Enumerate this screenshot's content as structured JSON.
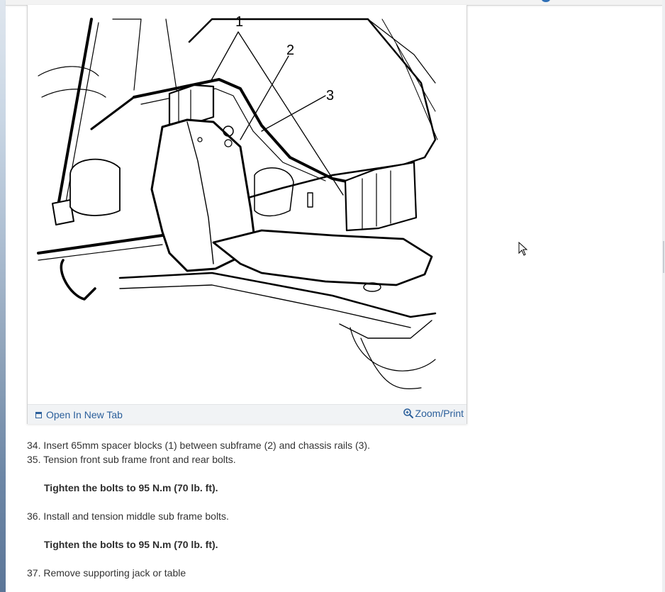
{
  "figure": {
    "callouts": [
      {
        "id": "callout-1",
        "label": "1"
      },
      {
        "id": "callout-2",
        "label": "2"
      },
      {
        "id": "callout-3",
        "label": "3"
      }
    ],
    "footer": {
      "open_new_tab_label": "Open In New Tab",
      "open_new_tab_icon": "open-new-tab-icon",
      "zoom_print_label": "Zoom/Print",
      "zoom_icon": "zoom-in-icon"
    }
  },
  "steps": [
    {
      "number": "34.",
      "text": "Insert 65mm spacer blocks (1) between subframe (2) and chassis rails (3).",
      "spec": ""
    },
    {
      "number": "35.",
      "text": "Tension front sub frame front and rear bolts.",
      "spec": "Tighten the bolts to 95 N.m (70 lb. ft)."
    },
    {
      "number": "36.",
      "text": "Install and tension middle sub frame bolts.",
      "spec": "Tighten the bolts to 95 N.m (70 lb. ft)."
    },
    {
      "number": "37.",
      "text": "Remove supporting jack or table",
      "spec": ""
    }
  ],
  "colors": {
    "link": "#2b5f9b",
    "text": "#333333",
    "footer_bg": "#f1f3f5"
  }
}
